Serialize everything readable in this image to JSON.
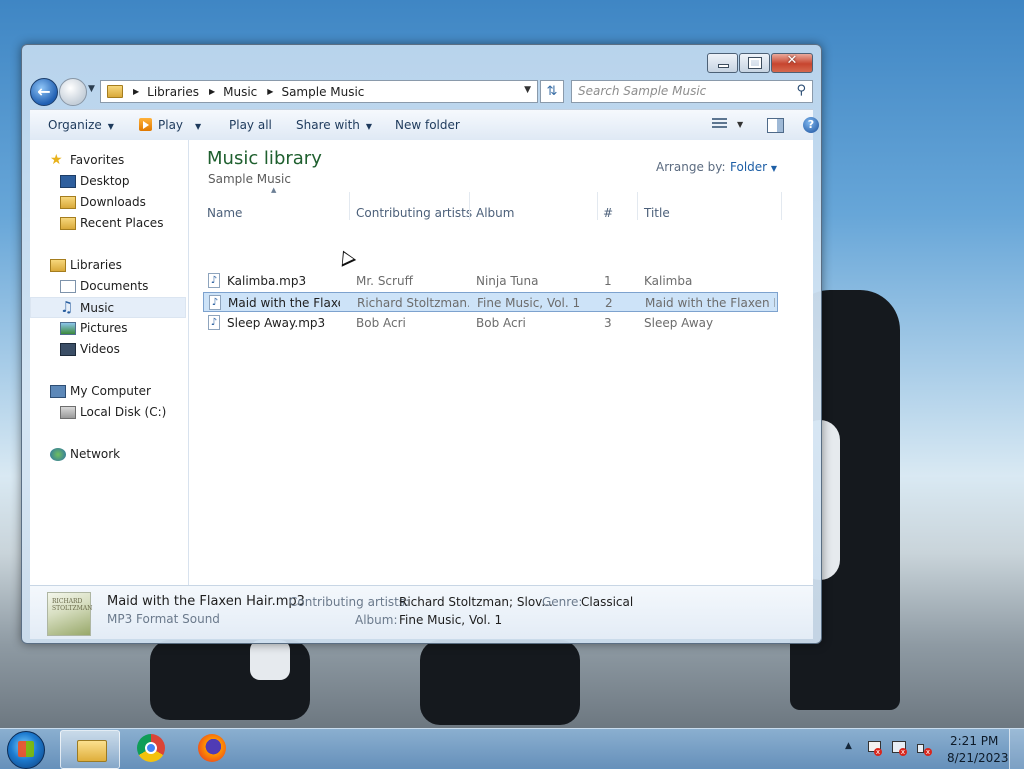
{
  "window": {
    "caption_buttons": {
      "minimize": "minimize",
      "maximize": "maximize",
      "close": "✕"
    }
  },
  "address": {
    "breadcrumbs": [
      "Libraries",
      "Music",
      "Sample Music"
    ]
  },
  "search": {
    "placeholder": "Search Sample Music"
  },
  "toolbar": {
    "organize": "Organize",
    "play": "Play",
    "play_all": "Play all",
    "share_with": "Share with",
    "new_folder": "New folder"
  },
  "nav": {
    "favorites": {
      "label": "Favorites",
      "items": [
        "Desktop",
        "Downloads",
        "Recent Places"
      ]
    },
    "libraries": {
      "label": "Libraries",
      "items": [
        "Documents",
        "Music",
        "Pictures",
        "Videos"
      ],
      "selected": "Music"
    },
    "computer": {
      "label": "My Computer",
      "items": [
        "Local Disk (C:)"
      ]
    },
    "network": {
      "label": "Network"
    }
  },
  "library": {
    "title": "Music library",
    "subtitle": "Sample Music",
    "arrange_label": "Arrange by:",
    "arrange_value": "Folder"
  },
  "table": {
    "columns": [
      "Name",
      "Contributing artists",
      "Album",
      "#",
      "Title"
    ],
    "rows": [
      {
        "name": "Kalimba.mp3",
        "artist": "Mr. Scruff",
        "album": "Ninja Tuna",
        "track": "1",
        "title": "Kalimba"
      },
      {
        "name": "Maid with the Flaxe...",
        "artist": "Richard Stoltzman...",
        "album": "Fine Music, Vol. 1",
        "track": "2",
        "title": "Maid with the Flaxen H..."
      },
      {
        "name": "Sleep Away.mp3",
        "artist": "Bob Acri",
        "album": "Bob Acri",
        "track": "3",
        "title": "Sleep Away"
      }
    ],
    "selected_row": 1
  },
  "details": {
    "filename": "Maid with the Flaxen Hair.mp3",
    "filetype": "MP3 Format Sound",
    "artists_label": "Contributing artists:",
    "artists_value": "Richard Stoltzman; Slov...",
    "genre_label": "Genre:",
    "genre_value": "Classical",
    "album_label": "Album:",
    "album_value": "Fine Music, Vol. 1",
    "album_art_text": "RICHARD STOLTZMAN"
  },
  "taskbar": {
    "pinned": [
      "windows-explorer-icon",
      "chrome-icon",
      "firefox-icon"
    ],
    "clock_time": "2:21 PM",
    "clock_date": "8/21/2023"
  },
  "colors": {
    "library_title": "#1e5f2e",
    "selection": "#cde3f8",
    "link_blue": "#1e5fa6"
  }
}
